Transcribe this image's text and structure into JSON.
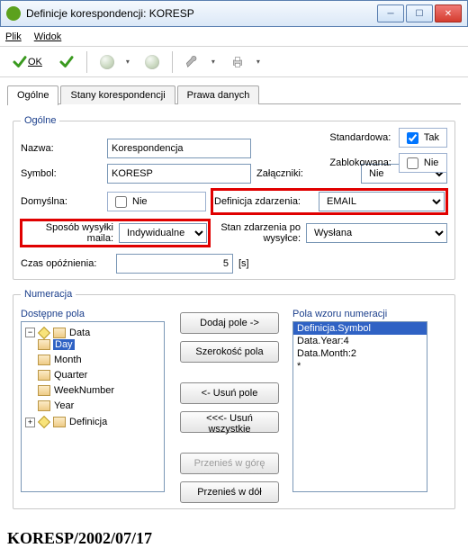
{
  "window": {
    "title": "Definicje korespondencji: KORESP"
  },
  "menu": {
    "file": "Plik",
    "view": "Widok"
  },
  "toolbar": {
    "ok_label": "OK"
  },
  "tabs": {
    "general": "Ogólne",
    "states": "Stany korespondencji",
    "rights": "Prawa danych"
  },
  "general": {
    "legend": "Ogólne",
    "name_label": "Nazwa:",
    "name_value": "Korespondencja",
    "symbol_label": "Symbol:",
    "symbol_value": "KORESP",
    "default_label": "Domyślna:",
    "default_text": "Nie",
    "attachments_label": "Załączniki:",
    "attachments_value": "Nie",
    "eventdef_label": "Definicja zdarzenia:",
    "eventdef_value": "EMAIL",
    "sendmode_label": "Sposób wysyłki maila:",
    "sendmode_value": "Indywidualne",
    "afterstate_label": "Stan zdarzenia po wysyłce:",
    "afterstate_value": "Wysłana",
    "delay_label": "Czas opóźnienia:",
    "delay_value": "5",
    "delay_unit": "[s]",
    "standard_label": "Standardowa:",
    "standard_text": "Tak",
    "locked_label": "Zablokowana:",
    "locked_text": "Nie"
  },
  "numbering": {
    "legend": "Numeracja",
    "available_label": "Dostępne pola",
    "pattern_label": "Pola wzoru numeracji",
    "tree": {
      "root1": "Data",
      "items": [
        "Day",
        "Month",
        "Quarter",
        "WeekNumber",
        "Year"
      ],
      "root2": "Definicja"
    },
    "list": [
      "Definicja.Symbol",
      "Data.Year:4",
      "Data.Month:2",
      "*"
    ],
    "buttons": {
      "add": "Dodaj pole ->",
      "width": "Szerokość pola",
      "remove": "<- Usuń pole",
      "remove_all": "<<<- Usuń wszystkie",
      "move_up": "Przenieś w górę",
      "move_down": "Przenieś w dół"
    }
  },
  "preview": "KORESP/2002/07/17"
}
